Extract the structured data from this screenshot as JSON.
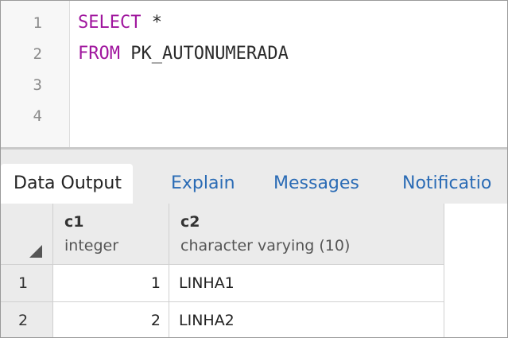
{
  "editor": {
    "line_numbers": [
      "1",
      "2",
      "3",
      "4"
    ],
    "lines": [
      {
        "keyword": "SELECT",
        "rest": " *"
      },
      {
        "keyword": "FROM",
        "rest": " PK_AUTONUMERADA"
      },
      {
        "keyword": "",
        "rest": ""
      },
      {
        "keyword": "",
        "rest": ""
      }
    ],
    "keyword_color": "#a0169e"
  },
  "tabs": [
    {
      "label": "Data Output",
      "active": true
    },
    {
      "label": "Explain",
      "active": false
    },
    {
      "label": "Messages",
      "active": false
    },
    {
      "label": "Notificatio",
      "active": false
    }
  ],
  "grid": {
    "columns": [
      {
        "name": "c1",
        "type": "integer"
      },
      {
        "name": "c2",
        "type": "character varying (10)"
      }
    ],
    "rows": [
      {
        "num": "1",
        "c1": "1",
        "c2": "LINHA1"
      },
      {
        "num": "2",
        "c1": "2",
        "c2": "LINHA2"
      }
    ]
  },
  "colors": {
    "link_tab": "#2a6bb5",
    "header_bg": "#ebebeb"
  }
}
